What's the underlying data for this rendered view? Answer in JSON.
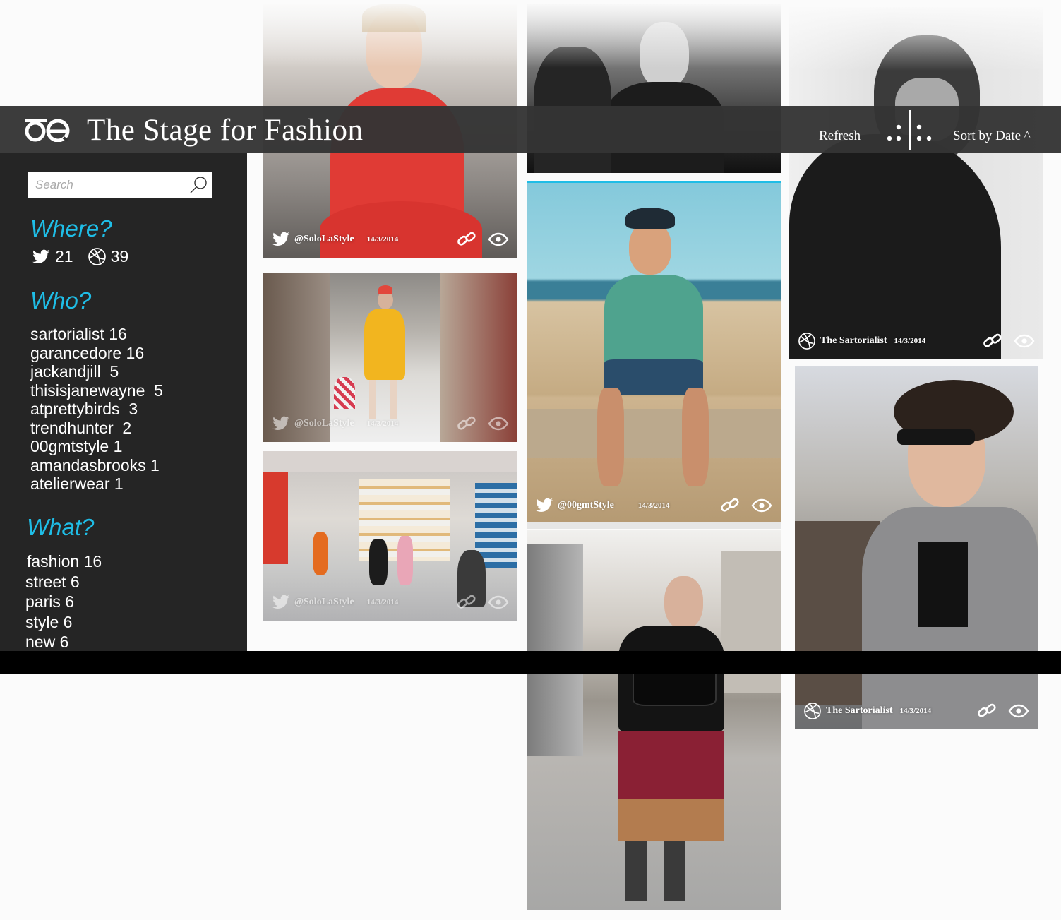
{
  "header": {
    "title": "The Stage for Fashion",
    "refresh_label": "Refresh",
    "sort_label": "Sort by Date ^",
    "logo_icon": "oe-logo-icon",
    "layout_icon": "grid-layout-icon"
  },
  "sidebar": {
    "search": {
      "placeholder": "Search",
      "value": ""
    },
    "where": {
      "title": "Where?",
      "twitter_count": "21",
      "dribbble_count": "39"
    },
    "who": {
      "title": "Who?",
      "items": [
        "sartorialist 16",
        "garancedore 16",
        "jackandjill  5",
        "thisisjanewayne  5",
        "atprettybirds  3",
        "trendhunter  2",
        "00gmtstyle 1",
        "amandasbrooks 1",
        "atelierwear 1"
      ]
    },
    "what": {
      "title": "What?",
      "items": [
        "fashion 16",
        "street 6",
        "paris 6",
        "style 6",
        "new 6"
      ]
    }
  },
  "feed": {
    "cards": [
      {
        "source": "twitter",
        "handle": "@SoloLaStyle",
        "date": "14/3/2014"
      },
      {
        "source": "twitter",
        "handle": "@SoloLaStyle",
        "date": "14/3/2014"
      },
      {
        "source": "twitter",
        "handle": "@SoloLaStyle",
        "date": "14/3/2014"
      },
      {
        "source": "twitter",
        "handle": "@00gmtStyle",
        "date": "14/3/2014"
      },
      {
        "source": "dribbble",
        "handle": "The Sartorialist",
        "date": "14/3/2014"
      },
      {
        "source": "dribbble",
        "handle": "The Sartorialist",
        "date": "14/3/2014"
      }
    ]
  },
  "colors": {
    "accent": "#1fbde6",
    "header_bg": "#343434",
    "sidebar_bg": "#252525",
    "band": "#000000"
  }
}
